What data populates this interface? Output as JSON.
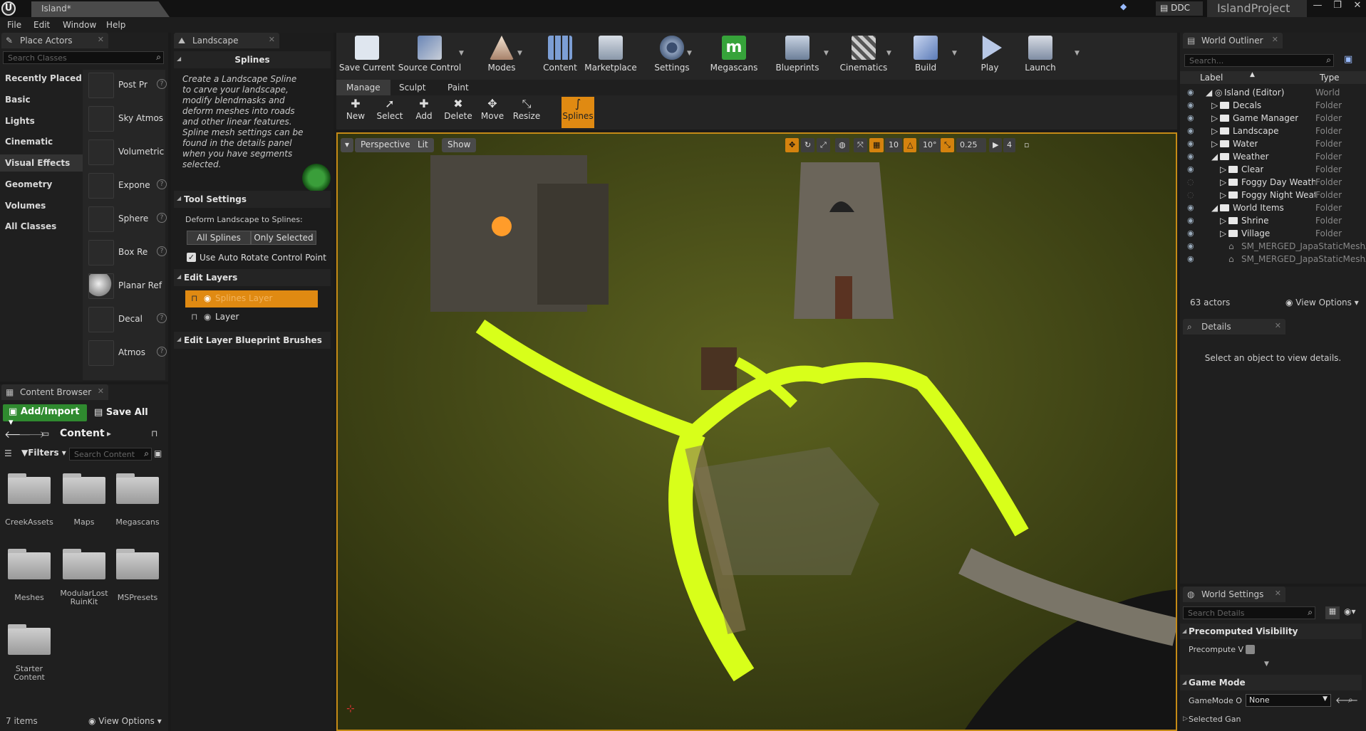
{
  "window": {
    "tab_title": "Island*",
    "ddc_label": "DDC",
    "project": "IslandProject"
  },
  "menu": [
    "File",
    "Edit",
    "Window",
    "Help"
  ],
  "place_actors": {
    "tab": "Place Actors",
    "search_placeholder": "Search Classes",
    "categories": [
      "Recently Placed",
      "Basic",
      "Lights",
      "Cinematic",
      "Visual Effects",
      "Geometry",
      "Volumes",
      "All Classes"
    ],
    "selected_category": "Visual Effects",
    "actors": [
      "Post Pr",
      "Sky Atmos",
      "Volumetric",
      "Expone",
      "Sphere",
      "Box Re",
      "Planar Ref",
      "Decal",
      "Atmos"
    ]
  },
  "landscape": {
    "tab": "Landscape",
    "section_splines": "Splines",
    "help": "Create a Landscape Spline to carve your landscape, modify blendmasks and deform meshes into roads and other linear features. Spline mesh settings can be found in the details panel when you have  segments selected.",
    "tool_settings": "Tool Settings",
    "deform_label": "Deform Landscape to Splines:",
    "all_splines": "All Splines",
    "only_selected": "Only Selected",
    "auto_rotate": "Use Auto Rotate Control Point",
    "edit_layers": "Edit Layers",
    "layers": [
      "Splines Layer",
      "Layer"
    ],
    "blueprint_brushes": "Edit Layer Blueprint Brushes"
  },
  "toolbar": [
    "Save Current",
    "Source Control",
    "Modes",
    "Content",
    "Marketplace",
    "Settings",
    "Megascans",
    "Blueprints",
    "Cinematics",
    "Build",
    "Play",
    "Launch"
  ],
  "mode_tabs": [
    "Manage",
    "Sculpt",
    "Paint"
  ],
  "spline_tools": [
    "New",
    "Select",
    "Add",
    "Delete",
    "Move",
    "Resize",
    "Splines"
  ],
  "viewport": {
    "perspective": "Perspective",
    "lit": "Lit",
    "show": "Show",
    "grid": "10",
    "angle": "10°",
    "scale": "0.25",
    "cam_speed": "4"
  },
  "content_browser": {
    "tab": "Content Browser",
    "add_import": "Add/Import",
    "save_all": "Save All",
    "path": "Content",
    "filters": "Filters",
    "search_placeholder": "Search Content",
    "folders": [
      "CreekAssets",
      "Maps",
      "Megascans",
      "Meshes",
      "ModularLost RuinKit",
      "MSPresets",
      "Starter Content"
    ],
    "count": "7 items",
    "view_options": "View Options"
  },
  "outliner": {
    "tab": "World Outliner",
    "search_placeholder": "Search...",
    "col_label": "Label",
    "col_type": "Type",
    "rows": [
      {
        "label": "Island (Editor)",
        "type": "World"
      },
      {
        "label": "Decals",
        "type": "Folder"
      },
      {
        "label": "Game Manager",
        "type": "Folder"
      },
      {
        "label": "Landscape",
        "type": "Folder"
      },
      {
        "label": "Water",
        "type": "Folder"
      },
      {
        "label": "Weather",
        "type": "Folder"
      },
      {
        "label": "Clear",
        "type": "Folder"
      },
      {
        "label": "Foggy Day Weather",
        "type": "Folder"
      },
      {
        "label": "Foggy Night Weather",
        "type": "Folder"
      },
      {
        "label": "World Items",
        "type": "Folder"
      },
      {
        "label": "Shrine",
        "type": "Folder"
      },
      {
        "label": "Village",
        "type": "Folder"
      },
      {
        "label": "SM_MERGED_JapaStaticMeshActor",
        "type": ""
      },
      {
        "label": "SM_MERGED_JapaStaticMeshActor",
        "type": ""
      }
    ],
    "count": "63 actors",
    "view_options": "View Options"
  },
  "details": {
    "tab": "Details",
    "empty": "Select an object to view details."
  },
  "world_settings": {
    "tab": "World Settings",
    "search_placeholder": "Search Details",
    "precomputed": "Precomputed Visibility",
    "precompute_v": "Precompute V",
    "game_mode": "Game Mode",
    "gamemode_o": "GameMode O",
    "gamemode_value": "None",
    "selected_gan": "Selected Gan"
  },
  "colors": {
    "accent": "#e08a12",
    "spline": "#d8ff1a"
  }
}
